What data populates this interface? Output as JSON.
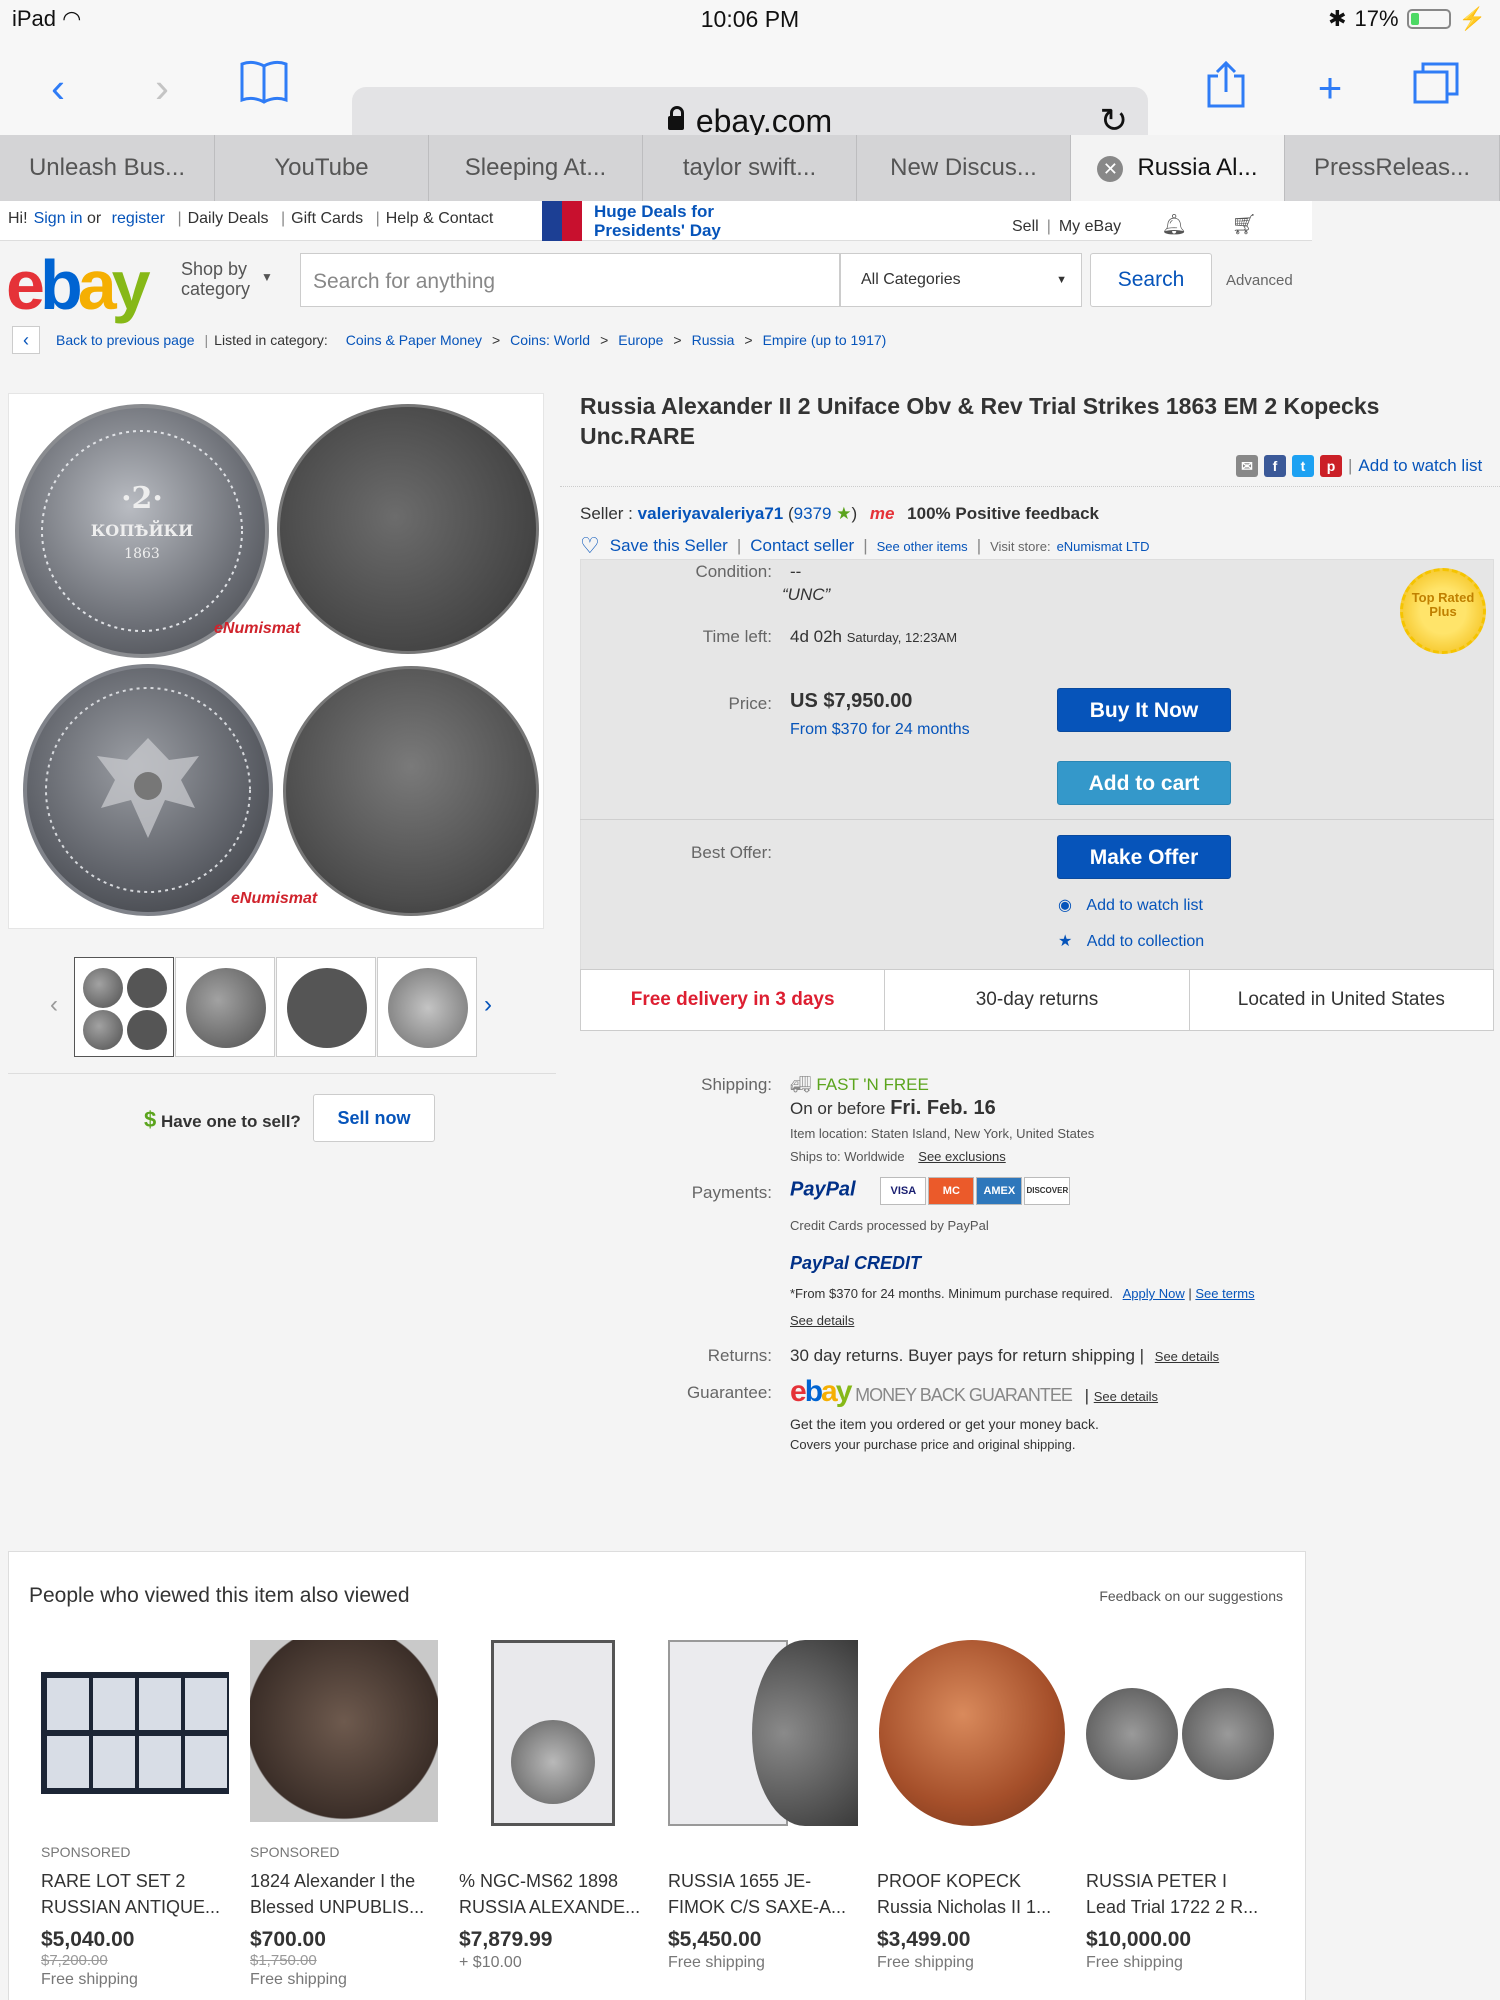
{
  "status": {
    "device": "iPad",
    "time": "10:06 PM",
    "battery": "17%"
  },
  "browser": {
    "url": "ebay.com",
    "tabs": [
      "Unleash Bus...",
      "YouTube",
      "Sleeping At...",
      "taylor swift...",
      "New Discus...",
      "Russia Al...",
      "PressReleas..."
    ],
    "active_tab": 5
  },
  "globalheader": {
    "hi": "Hi!",
    "sign_in": "Sign in",
    "or": "or",
    "register": "register",
    "daily_deals": "Daily Deals",
    "gift_cards": "Gift Cards",
    "help": "Help & Contact",
    "promo": "Huge Deals for Presidents' Day",
    "sell": "Sell",
    "my_ebay": "My eBay"
  },
  "searchbar": {
    "logo": [
      "e",
      "b",
      "a",
      "y"
    ],
    "shop_by": "Shop by category",
    "placeholder": "Search for anything",
    "category": "All Categories",
    "search": "Search",
    "advanced": "Advanced"
  },
  "breadcrumb": {
    "back": "Back to previous page",
    "listed": "Listed in category:",
    "items": [
      "Coins & Paper Money",
      "Coins: World",
      "Europe",
      "Russia",
      "Empire (up to 1917)"
    ]
  },
  "gallery": {
    "watermark": "eNumismat",
    "have_one": "Have one to sell?",
    "sell_now": "Sell now"
  },
  "item": {
    "title": "Russia Alexander II 2 Uniface Obv & Rev Trial Strikes 1863 EM 2 Kopecks Unc.RARE",
    "add_watch": "Add to watch list",
    "seller_label": "Seller :",
    "seller_name": "valeriyavaleriya71",
    "seller_score": "9379",
    "me": "me",
    "feedback": "100% Positive feedback",
    "save_seller": "Save this Seller",
    "contact_seller": "Contact seller",
    "see_other": "See other items",
    "visit_store": "Visit store:",
    "store_name": "eNumismat LTD",
    "condition_label": "Condition:",
    "condition_value": "--",
    "condition_quote": "“UNC”",
    "time_label": "Time left:",
    "time_value": "4d 02h",
    "time_end": "Saturday, 12:23AM",
    "seal": "Top Rated Plus",
    "price_label": "Price:",
    "price": "US $7,950.00",
    "financing": "From $370 for 24 months",
    "buy_now": "Buy It Now",
    "add_cart": "Add to cart",
    "offer_label": "Best Offer:",
    "make_offer": "Make Offer",
    "watch_list": "Add to watch list",
    "collection": "Add to collection",
    "free_delivery": "Free delivery in 3 days",
    "returns": "30-day returns",
    "located": "Located in United States"
  },
  "shipping": {
    "shipping_label": "Shipping:",
    "fast": "FAST 'N FREE",
    "on_before": "On or before",
    "date": "Fri. Feb. 16",
    "location": "Item location:  Staten Island, New York, United States",
    "ships_to": "Ships to:  Worldwide",
    "see_exclusions": "See exclusions",
    "payments_label": "Payments:",
    "paypal": "PayPal",
    "cards": [
      "VISA",
      "MC",
      "AMEX",
      "DISCOVER"
    ],
    "cc_processed": "Credit Cards processed by PayPal",
    "paypal_credit": "PayPal CREDIT",
    "credit_terms": "*From $370 for 24 months. Minimum purchase required.",
    "apply_now": "Apply Now",
    "see_terms": "See terms",
    "see_details": "See details",
    "returns_label": "Returns:",
    "returns_value": "30 day returns. Buyer pays for return shipping",
    "guarantee_label": "Guarantee:",
    "guarantee_text": "MONEY BACK GUARANTEE",
    "guarantee_line1": "Get the item you ordered or get your money back.",
    "guarantee_line2": "Covers your purchase price and original shipping."
  },
  "related": {
    "title": "People who viewed this item also viewed",
    "feedback": "Feedback on our suggestions",
    "items": [
      {
        "spon": "SPONSORED",
        "l1": "RARE LOT SET 2",
        "l2": "RUSSIAN ANTIQUE...",
        "price": "$5,040.00",
        "was": "$7,200.00",
        "ship": "Free shipping"
      },
      {
        "spon": "SPONSORED",
        "l1": "1824 Alexander I the",
        "l2": "Blessed UNPUBLIS...",
        "price": "$700.00",
        "was": "$1,750.00",
        "ship": "Free shipping"
      },
      {
        "spon": "",
        "l1": "% NGC-MS62 1898",
        "l2": "RUSSIA ALEXANDE...",
        "price": "$7,879.99",
        "was": "",
        "ship": "+ $10.00"
      },
      {
        "spon": "",
        "l1": "RUSSIA 1655 JE-",
        "l2": "FIMOK C/S SAXE-A...",
        "price": "$5,450.00",
        "was": "",
        "ship": "Free shipping"
      },
      {
        "spon": "",
        "l1": "PROOF KOPECK",
        "l2": "Russia Nicholas II 1...",
        "price": "$3,499.00",
        "was": "",
        "ship": "Free shipping"
      },
      {
        "spon": "",
        "l1": "RUSSIA PETER I",
        "l2": "Lead Trial 1722 2 R...",
        "price": "$10,000.00",
        "was": "",
        "ship": "Free shipping"
      }
    ]
  }
}
